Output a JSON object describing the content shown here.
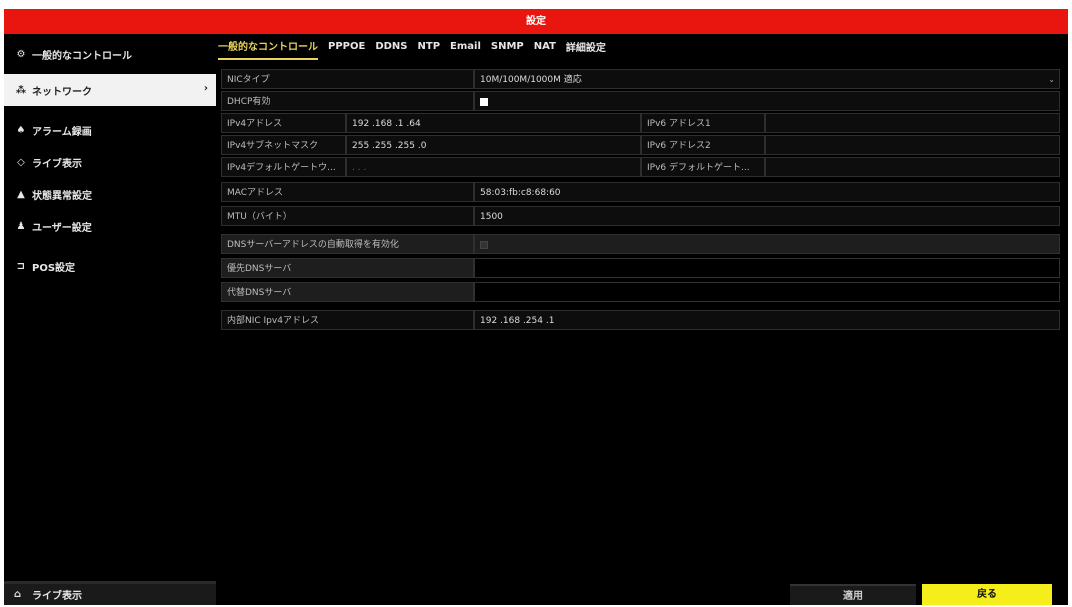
{
  "window": {
    "title": "設定"
  },
  "sidebar": {
    "items": [
      {
        "label": "一般的なコントロール",
        "icon": "gear-icon",
        "glyph": "⚙"
      },
      {
        "label": "ネットワーク",
        "icon": "network-icon",
        "glyph": "⁂",
        "active": true
      },
      {
        "label": "アラーム録画",
        "icon": "alarm-icon",
        "glyph": "♠"
      },
      {
        "label": "ライブ表示",
        "icon": "eye-icon",
        "glyph": "◇"
      },
      {
        "label": "状態異常設定",
        "icon": "warning-icon",
        "glyph": "▲"
      },
      {
        "label": "ユーザー設定",
        "icon": "users-icon",
        "glyph": "♟"
      },
      {
        "label": "POS設定",
        "icon": "pos-icon",
        "glyph": "⊐"
      }
    ],
    "bottom": {
      "label": "ライブ表示",
      "icon": "home-icon",
      "glyph": "⌂"
    }
  },
  "tabs": [
    {
      "label": "一般的なコントロール",
      "active": true
    },
    {
      "label": "PPPOE"
    },
    {
      "label": "DDNS"
    },
    {
      "label": "NTP"
    },
    {
      "label": "Email"
    },
    {
      "label": "SNMP"
    },
    {
      "label": "NAT"
    },
    {
      "label": "詳細設定"
    }
  ],
  "form": {
    "nic_type": {
      "label": "NICタイプ",
      "value": "10M/100M/1000M 適応"
    },
    "dhcp": {
      "label": "DHCP有効",
      "checked": true
    },
    "ipv4_addr": {
      "label": "IPv4アドレス",
      "value": "192 .168 .1    .64"
    },
    "ipv6_addr1": {
      "label": "IPv6 アドレス1",
      "value": ""
    },
    "ipv4_mask": {
      "label": "IPv4サブネットマスク",
      "value": "255 .255 .255 .0"
    },
    "ipv6_addr2": {
      "label": "IPv6 アドレス2",
      "value": ""
    },
    "ipv4_gw": {
      "label": "IPv4デフォルトゲートウ...",
      "value": "  .     .     ."
    },
    "ipv6_gw": {
      "label": "IPv6 デフォルトゲート...",
      "value": ""
    },
    "mac": {
      "label": "MACアドレス",
      "value": "58:03:fb:c8:68:60"
    },
    "mtu": {
      "label": "MTU（バイト）",
      "value": "1500"
    },
    "dns_auto": {
      "label": "DNSサーバーアドレスの自動取得を有効化",
      "checked": false
    },
    "dns_primary": {
      "label": "優先DNSサーバ",
      "value": ""
    },
    "dns_alt": {
      "label": "代替DNSサーバ",
      "value": ""
    },
    "internal_nic": {
      "label": "内部NIC Ipv4アドレス",
      "value": "192 .168 .254 .1"
    }
  },
  "buttons": {
    "apply": "適用",
    "back": "戻る"
  }
}
